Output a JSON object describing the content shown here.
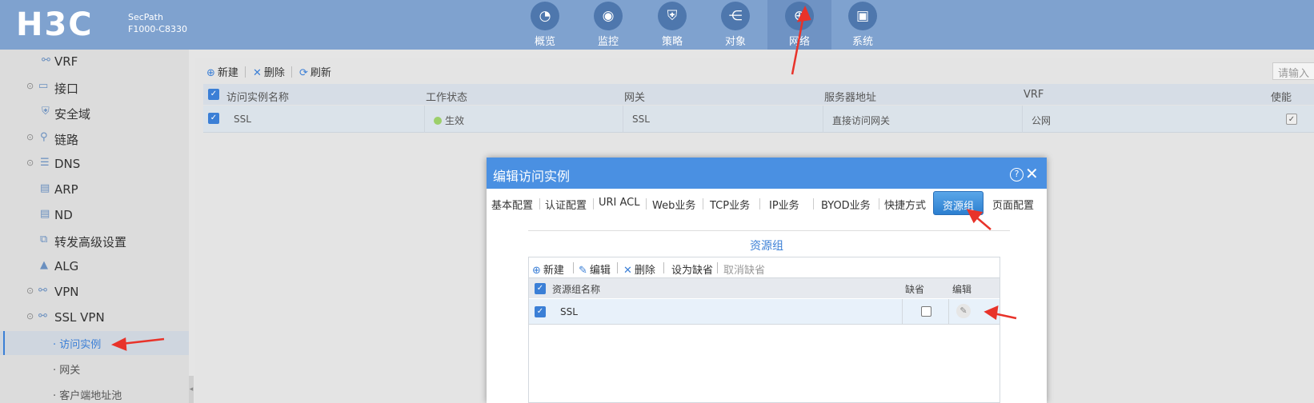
{
  "header": {
    "logo": "H3C",
    "model_line1": "SecPath",
    "model_line2": "F1000-C8330",
    "nav": [
      {
        "label": "概览",
        "icon": "dashboard-icon",
        "glyph": "◔"
      },
      {
        "label": "监控",
        "icon": "monitor-icon",
        "glyph": "◉"
      },
      {
        "label": "策略",
        "icon": "shield-icon",
        "glyph": "⛨"
      },
      {
        "label": "对象",
        "icon": "share-icon",
        "glyph": "⋲"
      },
      {
        "label": "网络",
        "icon": "globe-icon",
        "glyph": "⊕",
        "active": true
      },
      {
        "label": "系统",
        "icon": "system-icon",
        "glyph": "▣"
      }
    ]
  },
  "sidebar": {
    "items": [
      {
        "label": "VRF"
      },
      {
        "label": "接口"
      },
      {
        "label": "安全域"
      },
      {
        "label": "链路"
      },
      {
        "label": "DNS"
      },
      {
        "label": "ARP"
      },
      {
        "label": "ND"
      },
      {
        "label": "转发高级设置"
      },
      {
        "label": "ALG"
      },
      {
        "label": "VPN"
      },
      {
        "label": "SSL VPN"
      }
    ],
    "subitems": [
      {
        "label": "· 访问实例",
        "active": true
      },
      {
        "label": "· 网关"
      },
      {
        "label": "· 客户端地址池"
      }
    ]
  },
  "main": {
    "toolbar": {
      "new": "新建",
      "delete": "删除",
      "refresh": "刷新"
    },
    "search_placeholder": "请输入",
    "columns": [
      "访问实例名称",
      "工作状态",
      "网关",
      "服务器地址",
      "VRF",
      "使能"
    ],
    "row": {
      "name": "SSL",
      "status": "生效",
      "gateway": "SSL",
      "server": "直接访问网关",
      "vrf": "公网"
    }
  },
  "dialog": {
    "title": "编辑访问实例",
    "tabs": [
      "基本配置",
      "认证配置",
      "URI ACL",
      "Web业务",
      "TCP业务",
      "IP业务",
      "BYOD业务",
      "快捷方式",
      "资源组",
      "页面配置"
    ],
    "active_tab": "资源组",
    "section_title": "资源组",
    "toolbar": {
      "new": "新建",
      "edit": "编辑",
      "delete": "删除",
      "set_default": "设为缺省",
      "cancel_default": "取消缺省"
    },
    "columns": [
      "资源组名称",
      "缺省",
      "编辑"
    ],
    "row": {
      "name": "SSL"
    }
  },
  "colors": {
    "accent": "#3b7fd6",
    "header": "#7fa2cf",
    "dialog_title": "#4a90e2",
    "annotation": "#e8332a"
  }
}
